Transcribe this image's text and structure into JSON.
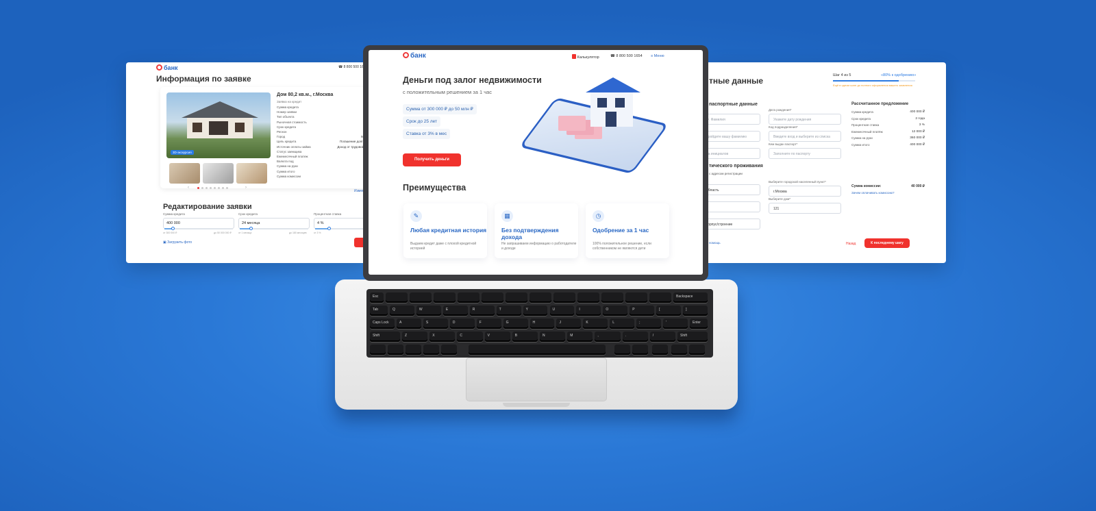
{
  "left": {
    "logo": "банк",
    "phone": "8 800 500 16",
    "title": "Информация по заявке",
    "property_title": "Дом 80,2 кв.м., г.Москва",
    "property_subtitle": "Заявка на кредит",
    "photo_badge": "3D-экскурсия",
    "fields": [
      "Сумма кредита",
      "Номер заявки",
      "Тип объекта",
      "Рыночная стоимость",
      "Срок кредита",
      "Регион",
      "Город",
      "Цель кредита",
      "Источник оплаты займа",
      "Статус заемщика",
      "Ежемесячный платеж",
      "Валюта под",
      "Сумма на руки",
      "Сумма итого",
      "Сумма комиссии"
    ],
    "values": [
      "",
      "",
      "",
      "3",
      "",
      "",
      "Москв",
      "Погашение долгов (и",
      "Доход от трудовой дея",
      "",
      "",
      "",
      "",
      "",
      ""
    ],
    "link": "Измен",
    "edit_title": "Редактирование заявки",
    "sliders": [
      {
        "label": "Сумма кредита",
        "value": "400 000",
        "min": "от 300 000 ₽",
        "max": "до 50 000 000 ₽"
      },
      {
        "label": "Срок кредита",
        "value": "24 месяца",
        "min": "от 1 месяца",
        "max": "до 180 месяцев"
      },
      {
        "label": "Процентная ставка",
        "value": "4 %",
        "min": "от 3 %",
        "max": ""
      }
    ],
    "upload": "Загрузить фото"
  },
  "right": {
    "title": "тные данные",
    "step": "Шаг 4 из 5",
    "progress_note": "«80% к одобрению»",
    "progress_pct": 80,
    "hint": "Ещё в одном шаге до полного оформления вашего заявления",
    "section1": "паспортные данные",
    "left_fields": [
      "Ф. Фамилия",
      "пройдите вашу фамилию",
      "на инициалов"
    ],
    "right_labels": [
      "Дата рождения*",
      "Код подразделения*",
      "Кем выдан паспорт*"
    ],
    "right_placeholders": [
      "Укажите дату рождения",
      "Введите вход и выберите из списка",
      "Заполните по паспорту"
    ],
    "section2": "тического проживания",
    "section2_note": "с адресом регистрации",
    "addr_labels": [
      "Выберите городской населенный пункт*",
      "Выберите дом*"
    ],
    "addr_values": [
      "г.Москва",
      "121"
    ],
    "left_addr": [
      "область",
      "",
      "корпус/строение"
    ],
    "back": "помощь",
    "offer_title": "Рассчитанное предложение",
    "offer_rows": [
      [
        "Сумма кредита",
        "400 000 ₽"
      ],
      [
        "Срок кредита",
        "2 года"
      ],
      [
        "Процентная ставка",
        "3 %"
      ],
      [
        "Ежемесячный платёж",
        "12 000 ₽"
      ],
      [
        "Сумма на руки",
        "360 000 ₽"
      ],
      [
        "Сумма итого",
        "400 000 ₽"
      ]
    ],
    "commission_label": "Сумма комиссии:",
    "commission_value": "40 000 ₽",
    "offer_link": "Зачем оплачивать комиссию?",
    "reset": "Назад",
    "next": "К последнему шагу"
  },
  "center": {
    "logo": "банк",
    "calc": "Калькулятор",
    "phone": "8 800 500 1654",
    "menu": "Меню",
    "hero_title": "Деньги под залог недвижимости",
    "hero_sub": "с положительным решением за 1 час",
    "chips": [
      "Сумма от 300 000 ₽ до 50 млн ₽",
      "Срок до 25 лет",
      "Ставка от 3% в мес"
    ],
    "cta": "Получить деньги",
    "adv_title": "Преимущества",
    "cards": [
      {
        "title": "Любая кредитная история",
        "desc": "Выдаем кредит даже с плохой кредитной историей"
      },
      {
        "title": "Без подтверждения дохода",
        "desc": "Не запрашиваем информацию о работодателе и доходе"
      },
      {
        "title": "Одобрение за 1 час",
        "desc": "100% положительное решение, если собственником не являются дети"
      }
    ]
  },
  "keyboard": {
    "row1": [
      "Esc",
      "",
      "",
      "",
      "",
      "",
      "",
      "",
      "",
      "",
      "",
      "",
      "",
      "Backspace"
    ],
    "row2": [
      "Tab",
      "Q",
      "W",
      "E",
      "R",
      "T",
      "Y",
      "U",
      "I",
      "O",
      "P",
      "[",
      "]"
    ],
    "row3": [
      "Caps Lock",
      "A",
      "S",
      "D",
      "F",
      "G",
      "H",
      "J",
      "K",
      "L",
      ";",
      "'",
      "Enter"
    ],
    "row4": [
      "Shift",
      "Z",
      "X",
      "C",
      "V",
      "B",
      "N",
      "M",
      ",",
      ".",
      "/",
      "Shift"
    ]
  },
  "colors": {
    "accent_blue": "#2a68c4",
    "accent_red": "#f0322d",
    "bg": "#2a78d6"
  }
}
